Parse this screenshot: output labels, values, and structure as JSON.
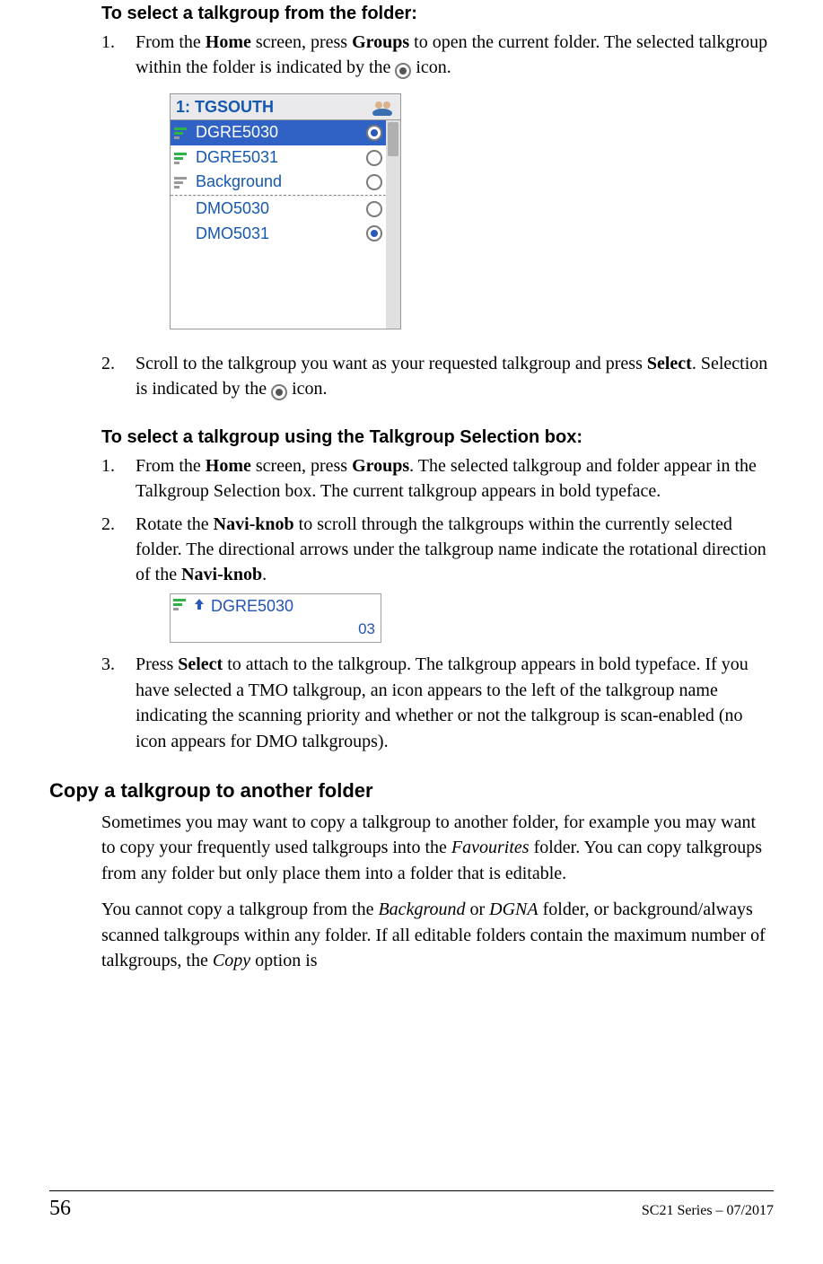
{
  "headings": {
    "select_from_folder": "To select a talkgroup from the folder:",
    "select_using_box": "To select a talkgroup using the Talkgroup Selection box:",
    "copy_section": "Copy a talkgroup to another folder"
  },
  "steps_folder": {
    "s1_a": "From the ",
    "s1_b_home": "Home",
    "s1_c": " screen, press ",
    "s1_d_groups": "Groups",
    "s1_e": " to open the current folder. The selected talkgroup within the folder is indicated by the ",
    "s1_f": " icon.",
    "s2_a": "Scroll to the talkgroup you want as your requested talkgroup and press ",
    "s2_b_select": "Select",
    "s2_c": ". Selection is indicated by the ",
    "s2_d": " icon."
  },
  "steps_box": {
    "s1_a": "From the ",
    "s1_b_home": "Home",
    "s1_c": " screen, press ",
    "s1_d_groups": "Groups",
    "s1_e": ". The selected talkgroup and folder appear in the Talkgroup Selection box. The current talkgroup appears in bold typeface.",
    "s2_a": "Rotate the ",
    "s2_b_navi": "Navi-knob",
    "s2_c": " to scroll through the talkgroups within the currently selected folder. The directional arrows under the talkgroup name indicate the rotational direction of the ",
    "s2_d_navi": "Navi-knob",
    "s2_e": ".",
    "s3_a": "Press ",
    "s3_b_select": "Select",
    "s3_c": " to attach to the talkgroup. The talkgroup appears in bold typeface. If you have selected a TMO talkgroup, an icon appears to the left of the talkgroup name indicating the scanning priority and whether or not the talkgroup is scan-enabled (no icon appears for DMO talkgroups)."
  },
  "copy_para1_a": "Sometimes you may want to copy a talkgroup to another folder, for example you may want to copy your frequently used talkgroups into the ",
  "copy_para1_b_italic": "Favourites",
  "copy_para1_c": " folder. You can copy talkgroups from any folder but only place them into a folder that is editable.",
  "copy_para2_a": "You cannot copy a talkgroup from the ",
  "copy_para2_b_italic": "Background",
  "copy_para2_c": " or ",
  "copy_para2_d_italic": "DGNA",
  "copy_para2_e": " folder, or background/always scanned talkgroups within any folder. If all editable folders contain the maximum number of talkgroups, the ",
  "copy_para2_f_italic": "Copy",
  "copy_para2_g": " option is",
  "tg_figure": {
    "title": "1: TGSOUTH",
    "rows": [
      {
        "label": "DGRE5030",
        "selected": true,
        "icon": "bars-green",
        "radio": "on"
      },
      {
        "label": "DGRE5031",
        "selected": false,
        "icon": "bars-green",
        "radio": "off"
      },
      {
        "label": "Background",
        "selected": false,
        "icon": "bars-grey",
        "radio": "off"
      }
    ],
    "dmo_rows": [
      {
        "label": "DMO5030",
        "selected": false,
        "icon": "",
        "radio": "off"
      },
      {
        "label": "DMO5031",
        "selected": false,
        "icon": "",
        "radio": "on"
      }
    ]
  },
  "sel_figure": {
    "name": "DGRE5030",
    "index": "03"
  },
  "step_numbers": {
    "n1": "1.",
    "n2": "2.",
    "n3": "3."
  },
  "footer": {
    "page": "56",
    "meta": "SC21 Series – 07/2017"
  }
}
